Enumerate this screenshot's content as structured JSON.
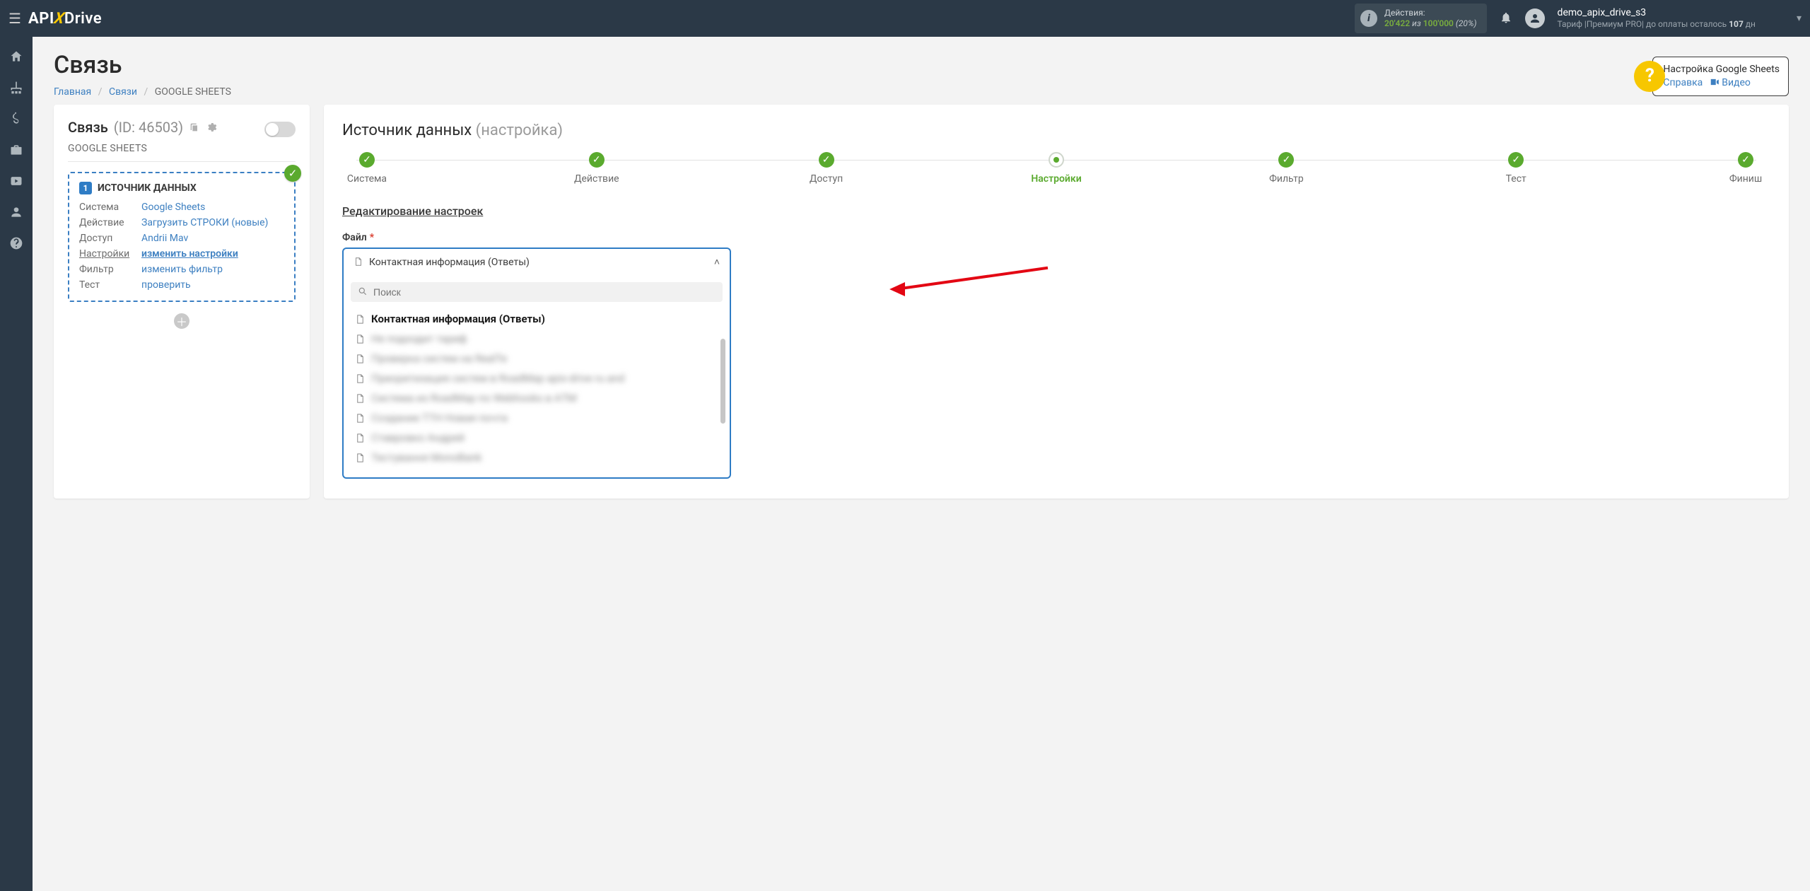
{
  "topbar": {
    "actions_label": "Действия:",
    "actions_used": "20'422",
    "actions_mid": "из",
    "actions_total": "100'000",
    "actions_pct": "(20%)",
    "user_name": "demo_apix_drive_s3",
    "tariff_prefix": "Тариф |Премиум PRO| до оплаты осталось ",
    "days_left": "107",
    "days_unit": " дн"
  },
  "page": {
    "title": "Связь"
  },
  "breadcrumbs": {
    "home": "Главная",
    "links": "Связи",
    "current": "GOOGLE SHEETS"
  },
  "help": {
    "title": "Настройка Google Sheets",
    "ref": "Справка",
    "video": "Видео"
  },
  "left": {
    "label": "Связь",
    "id": "(ID: 46503)",
    "system_name": "GOOGLE SHEETS",
    "box_title": "ИСТОЧНИК ДАННЫХ",
    "rows": {
      "system_k": "Система",
      "system_v": "Google Sheets",
      "action_k": "Действие",
      "action_v": "Загрузить СТРОКИ (новые)",
      "access_k": "Доступ",
      "access_v": "Andrii Mav",
      "settings_k": "Настройки",
      "settings_v": "изменить настройки",
      "filter_k": "Фильтр",
      "filter_v": "изменить фильтр",
      "test_k": "Тест",
      "test_v": "проверить"
    }
  },
  "right": {
    "title": "Источник данных",
    "title_muted": "(настройка)",
    "edit_label": "Редактирование настроек",
    "file_label": "Файл",
    "selected": "Контактная информация (Ответы)",
    "search_ph": "Поиск",
    "options": {
      "o1": "Контактная информация (Ответы)",
      "o2": "Не подходит тариф",
      "o3": "Проверка систем на RealTe",
      "o4": "Приоритизация систем в RoadMap apix-drive ru and",
      "o5": "Система из RoadMap по Webhooks в AТМ",
      "o6": "Создание ТТН Новая почта",
      "o7": "Ставровко Андрей",
      "o8": "Тестування MonoBank"
    }
  },
  "steps": {
    "s1": "Система",
    "s2": "Действие",
    "s3": "Доступ",
    "s4": "Настройки",
    "s5": "Фильтр",
    "s6": "Тест",
    "s7": "Финиш"
  }
}
